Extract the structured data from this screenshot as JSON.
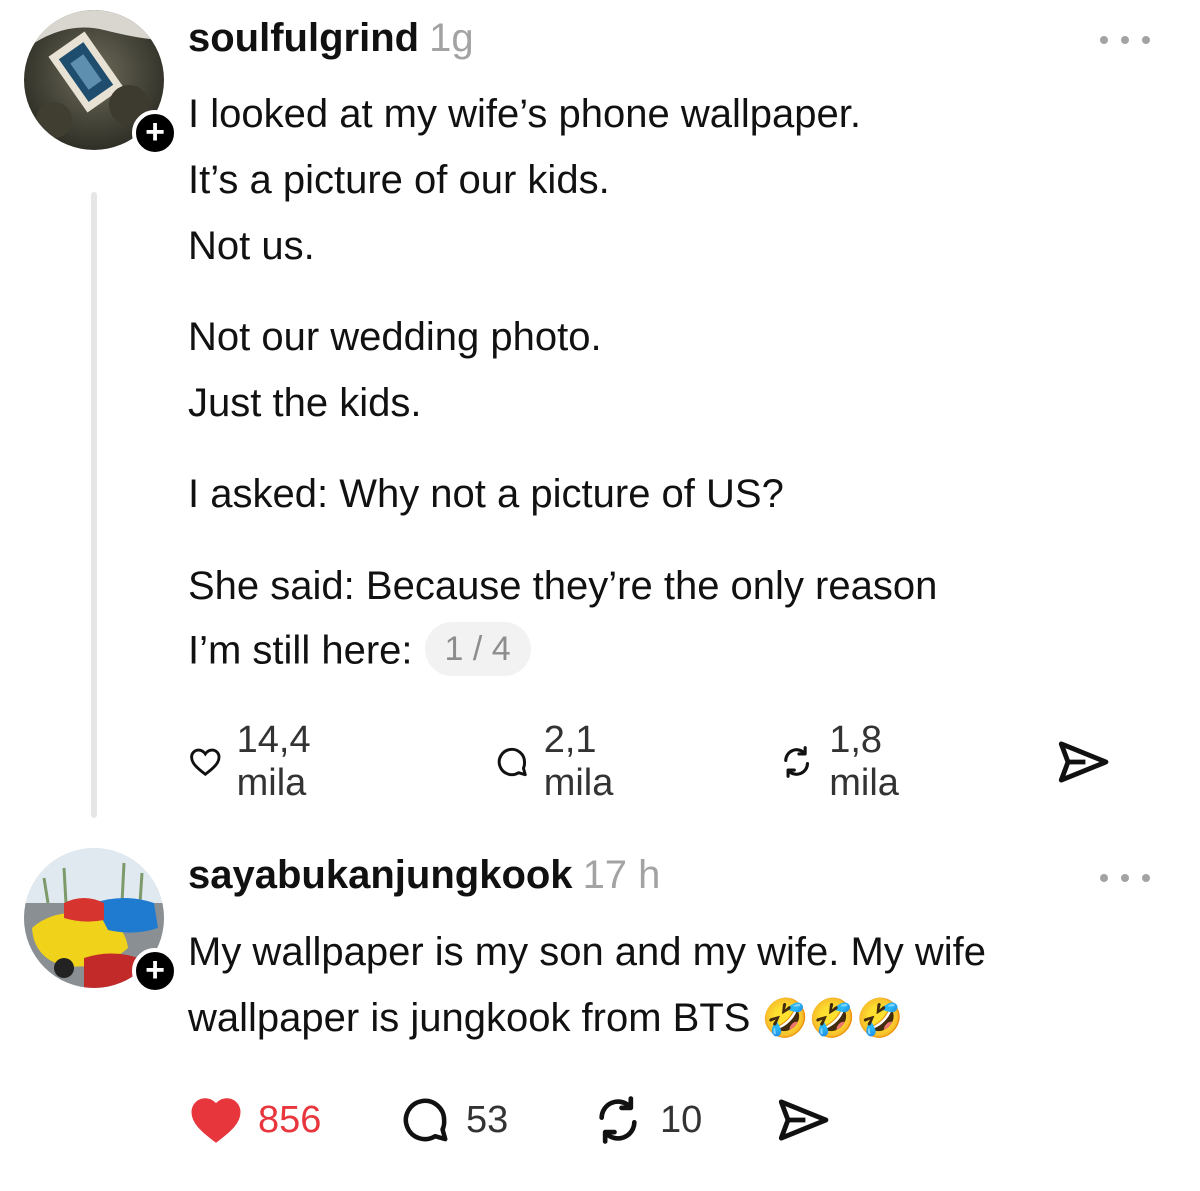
{
  "posts": [
    {
      "username": "soulfulgrind",
      "time": "1g",
      "lines": [
        "I looked at my wife’s phone wallpaper.",
        "It’s a picture of our kids.",
        "Not us.",
        "Not our wedding photo.",
        "Just the kids.",
        "I asked: Why not a picture of US?",
        "She said: Because they’re the only reason",
        "I’m still here:"
      ],
      "page_indicator": "1 / 4",
      "likes": "14,4 mila",
      "replies": "2,1 mila",
      "reposts": "1,8 mila",
      "liked": false,
      "icons": [
        "follow-plus-icon",
        "more-icon",
        "heart-icon",
        "comment-icon",
        "repost-icon",
        "share-icon"
      ]
    },
    {
      "username": "sayabukanjungkook",
      "time": "17 h",
      "lines": [
        "My wallpaper is my son and my wife. My wife",
        "wallpaper is jungkook from BTS"
      ],
      "emoji": "🤣🤣🤣",
      "likes": "856",
      "replies": "53",
      "reposts": "10",
      "liked": true,
      "like_color": "#e8363d"
    }
  ]
}
